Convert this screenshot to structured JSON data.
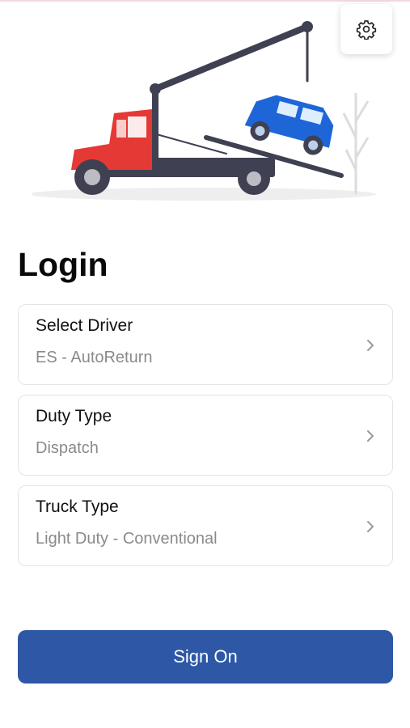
{
  "header": {
    "settings_icon": "gear-icon",
    "illustration": "tow-truck-lifting-car"
  },
  "page": {
    "title": "Login"
  },
  "fields": [
    {
      "label": "Select Driver",
      "value": "ES - AutoReturn",
      "icon": "chevron-right-icon"
    },
    {
      "label": "Duty Type",
      "value": "Dispatch",
      "icon": "chevron-right-icon"
    },
    {
      "label": "Truck Type",
      "value": "Light Duty - Conventional",
      "icon": "chevron-right-icon"
    }
  ],
  "actions": {
    "sign_on_label": "Sign On"
  },
  "colors": {
    "primary": "#2e58a6",
    "truck_cab": "#e53935",
    "car": "#1e66d8",
    "boom": "#3f4152"
  }
}
